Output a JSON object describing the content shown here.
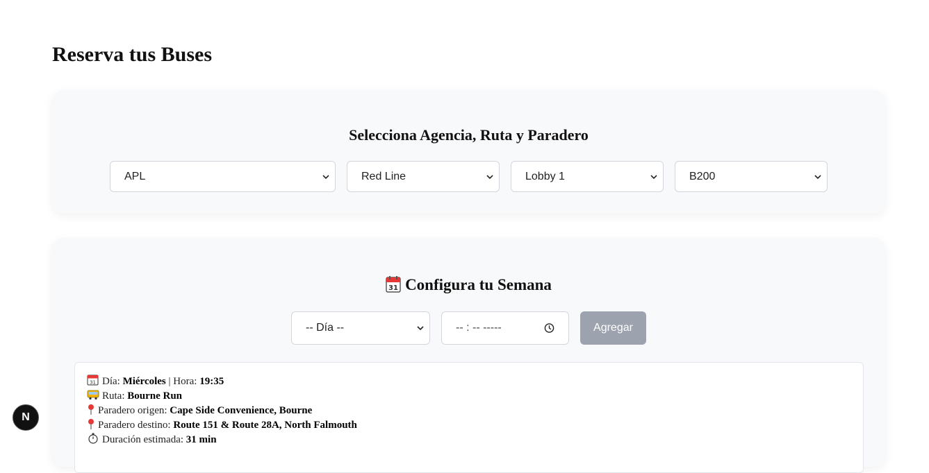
{
  "page": {
    "title": "Reserva tus Buses"
  },
  "selection": {
    "heading": "Selecciona Agencia, Ruta y Paradero",
    "agency": "APL",
    "route": "Red Line",
    "stop": "Lobby 1",
    "bus": "B200"
  },
  "week": {
    "heading": "Configura tu Semana",
    "day_select": "-- Día --",
    "time_placeholder": "-- : --  -----",
    "add_button": "Agregar"
  },
  "entry": {
    "day_label": "Día:",
    "day_value": "Miércoles",
    "separator": "|",
    "time_label": "Hora:",
    "time_value": "19:35",
    "route_label": "Ruta:",
    "route_value": "Bourne Run",
    "origin_label": "Paradero origen:",
    "origin_value": "Cape Side Convenience, Bourne",
    "dest_label": "Paradero destino:",
    "dest_value": "Route 151 & Route 28A, North Falmouth",
    "duration_label": "Duración estimada:",
    "duration_value": "31 min"
  },
  "badge": {
    "letter": "N"
  },
  "colors": {
    "card_bg": "#f8f9fb",
    "button_disabled": "#9ca3af",
    "pin_red": "#e53935"
  }
}
